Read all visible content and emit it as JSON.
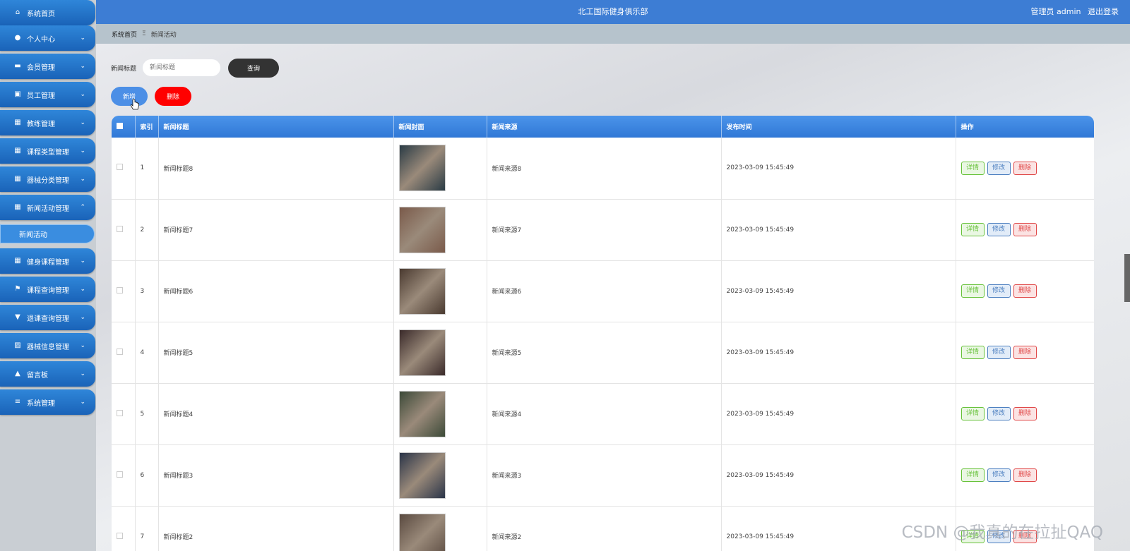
{
  "header": {
    "title": "北工国际健身俱乐部",
    "user_label": "管理员 admin",
    "logout_label": "退出登录"
  },
  "sidebar": {
    "items": [
      {
        "label": "系统首页",
        "icon": "home-icon",
        "glyph": "⌂",
        "chevron": false
      },
      {
        "label": "个人中心",
        "icon": "user-icon",
        "glyph": "●",
        "chevron": true
      },
      {
        "label": "会员管理",
        "icon": "monitor-icon",
        "glyph": "▬",
        "chevron": true
      },
      {
        "label": "员工管理",
        "icon": "clipboard-icon",
        "glyph": "▣",
        "chevron": true
      },
      {
        "label": "教练管理",
        "icon": "grid-icon",
        "glyph": "▦",
        "chevron": true
      },
      {
        "label": "课程类型管理",
        "icon": "table-icon",
        "glyph": "▦",
        "chevron": true
      },
      {
        "label": "器械分类管理",
        "icon": "grid-icon",
        "glyph": "▦",
        "chevron": true
      },
      {
        "label": "新闻活动管理",
        "icon": "grid-icon",
        "glyph": "▦",
        "chevron": "up"
      },
      {
        "label": "健身课程管理",
        "icon": "grid-icon",
        "glyph": "▦",
        "chevron": true
      },
      {
        "label": "课程查询管理",
        "icon": "flag-icon",
        "glyph": "⚑",
        "chevron": true
      },
      {
        "label": "退课查询管理",
        "icon": "pin-icon",
        "glyph": "▼",
        "chevron": true
      },
      {
        "label": "器械信息管理",
        "icon": "chart-icon",
        "glyph": "▨",
        "chevron": true
      },
      {
        "label": "留言板",
        "icon": "thumb-icon",
        "glyph": "▲",
        "chevron": true
      },
      {
        "label": "系统管理",
        "icon": "menu-icon",
        "glyph": "≡",
        "chevron": true
      }
    ],
    "active_sub": "新闻活动"
  },
  "breadcrumb": {
    "home": "系统首页",
    "separator": "Ξ",
    "current": "新闻活动"
  },
  "search": {
    "label": "新闻标题",
    "placeholder": "新闻标题",
    "query_button": "查询"
  },
  "actions": {
    "add_button": "新增",
    "delete_button": "删除"
  },
  "table": {
    "columns": [
      "索引",
      "新闻标题",
      "新闻封面",
      "新闻来源",
      "发布时间",
      "操作"
    ],
    "rows": [
      {
        "index": "1",
        "title": "新闻标题8",
        "source": "新闻来源8",
        "time": "2023-03-09 15:45:49",
        "cover_color": "#2a3b45"
      },
      {
        "index": "2",
        "title": "新闻标题7",
        "source": "新闻来源7",
        "time": "2023-03-09 15:45:49",
        "cover_color": "#7a5a4a"
      },
      {
        "index": "3",
        "title": "新闻标题6",
        "source": "新闻来源6",
        "time": "2023-03-09 15:45:49",
        "cover_color": "#4a3a30"
      },
      {
        "index": "4",
        "title": "新闻标题5",
        "source": "新闻来源5",
        "time": "2023-03-09 15:45:49",
        "cover_color": "#3a2a2a"
      },
      {
        "index": "5",
        "title": "新闻标题4",
        "source": "新闻来源4",
        "time": "2023-03-09 15:45:49",
        "cover_color": "#3c4a38"
      },
      {
        "index": "6",
        "title": "新闻标题3",
        "source": "新闻来源3",
        "time": "2023-03-09 15:45:49",
        "cover_color": "#2a3448"
      },
      {
        "index": "7",
        "title": "新闻标题2",
        "source": "新闻来源2",
        "time": "2023-03-09 15:45:49",
        "cover_color": "#5a4a40"
      }
    ],
    "op_detail": "详情",
    "op_edit": "修改",
    "op_delete": "删除"
  },
  "watermark": "CSDN @我真的在拉扯QAQ"
}
